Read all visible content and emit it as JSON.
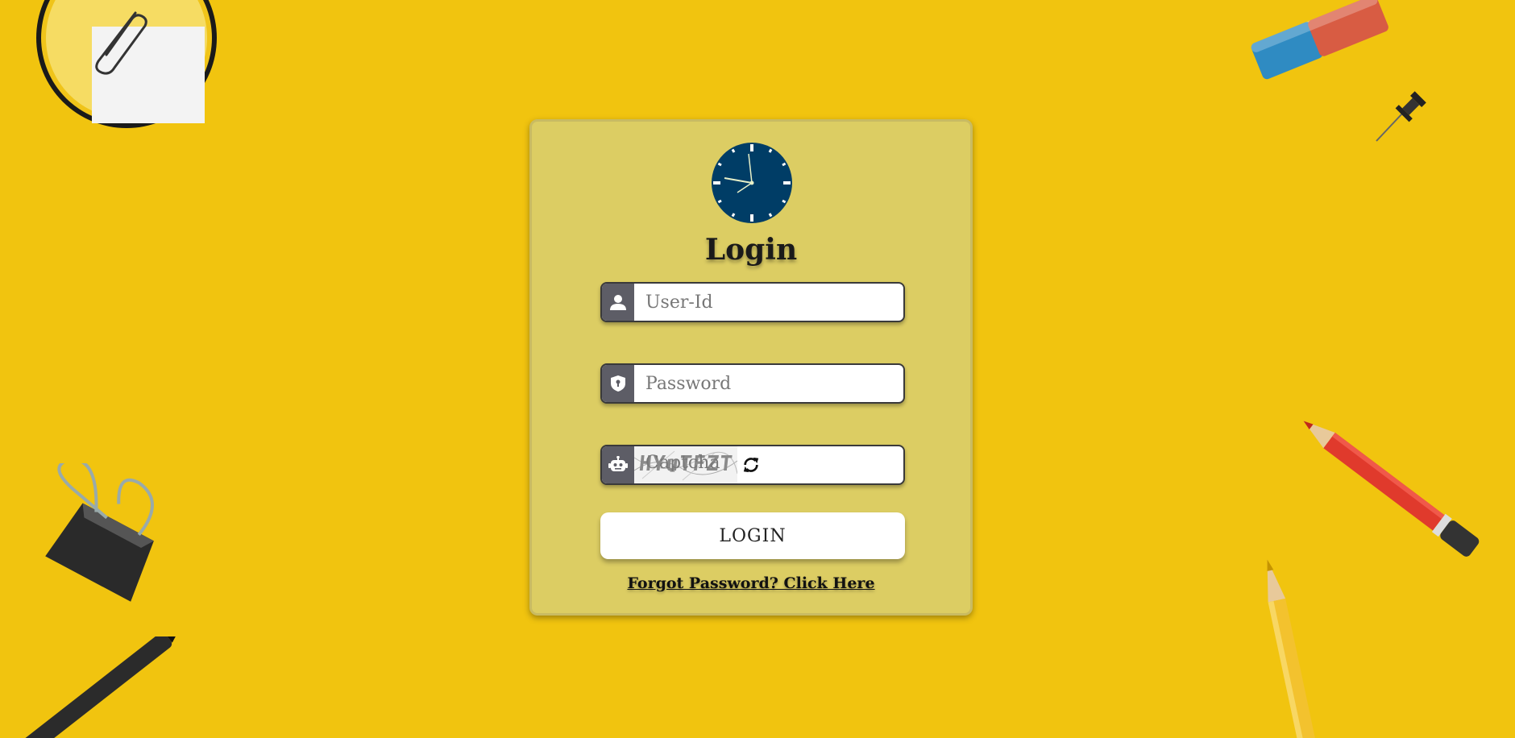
{
  "page": {
    "background_color": "#f1c40f",
    "card_color": "#dccd63",
    "title": "Login"
  },
  "form": {
    "userid": {
      "placeholder": "User-Id",
      "value": "",
      "icon": "user-icon"
    },
    "password": {
      "placeholder": "Password",
      "value": "",
      "icon": "shield-icon"
    },
    "captcha": {
      "image_text": "HYuTFZT",
      "placeholder": "Captcha",
      "value": "",
      "icon": "robot-icon",
      "refresh_icon": "refresh-icon"
    },
    "login_label": "LOGIN",
    "forgot_label": "Forgot Password? Click Here"
  },
  "decorations": [
    "clock-icon",
    "paperclip-icon",
    "sticky-note",
    "eraser",
    "pushpin",
    "binder-clip",
    "marker-pen",
    "red-pencil",
    "yellow-pencil"
  ]
}
